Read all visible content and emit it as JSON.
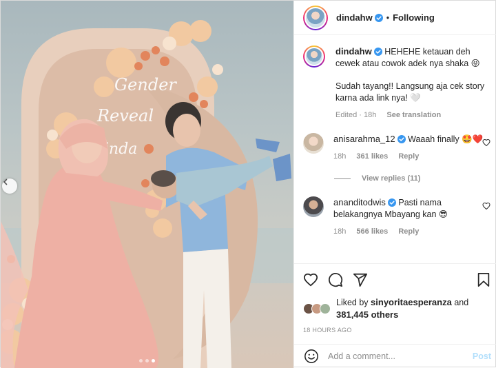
{
  "header": {
    "username": "dindahw",
    "separator": "•",
    "follow_status": "Following"
  },
  "caption": {
    "username": "dindahw",
    "text": "HEHEHE ketauan deh cewek atau cowok adek nya shaka 😝",
    "text2": "Sudah tayang!! Langsung aja cek story karna ada link nya! 🤍",
    "edited_time": "Edited · 18h",
    "see_translation": "See translation"
  },
  "comments": [
    {
      "username": "anisarahma_12",
      "text": "Waaah finally 🤩❤️",
      "time": "18h",
      "likes": "361 likes",
      "reply": "Reply",
      "view_replies": "View replies (11)"
    },
    {
      "username": "ananditodwis",
      "text": "Pasti nama belakangnya Mbayang kan 😎",
      "time": "18h",
      "likes": "566 likes",
      "reply": "Reply"
    }
  ],
  "likes": {
    "prefix": "Liked by",
    "liker": "sinyoritaesperanza",
    "and": "and",
    "others": "381,445 others"
  },
  "timestamp": "18 HOURS AGO",
  "add_comment": {
    "placeholder": "Add a comment...",
    "post_label": "Post"
  },
  "photo": {
    "sign_line1": "Gender",
    "sign_line2": "Reveal",
    "sign_line3": "inda",
    "carousel_count": 3,
    "carousel_active": 3
  },
  "icons": {
    "prev": "chevron-left-icon",
    "heart": "heart-icon",
    "comment": "comment-icon",
    "share": "paper-plane-icon",
    "save": "bookmark-icon",
    "emoji": "smiley-icon",
    "verified": "verified-badge-icon"
  },
  "colors": {
    "verified": "#3897f0",
    "link_disabled": "#b2dffc",
    "secondary_text": "#8e8e8e"
  }
}
